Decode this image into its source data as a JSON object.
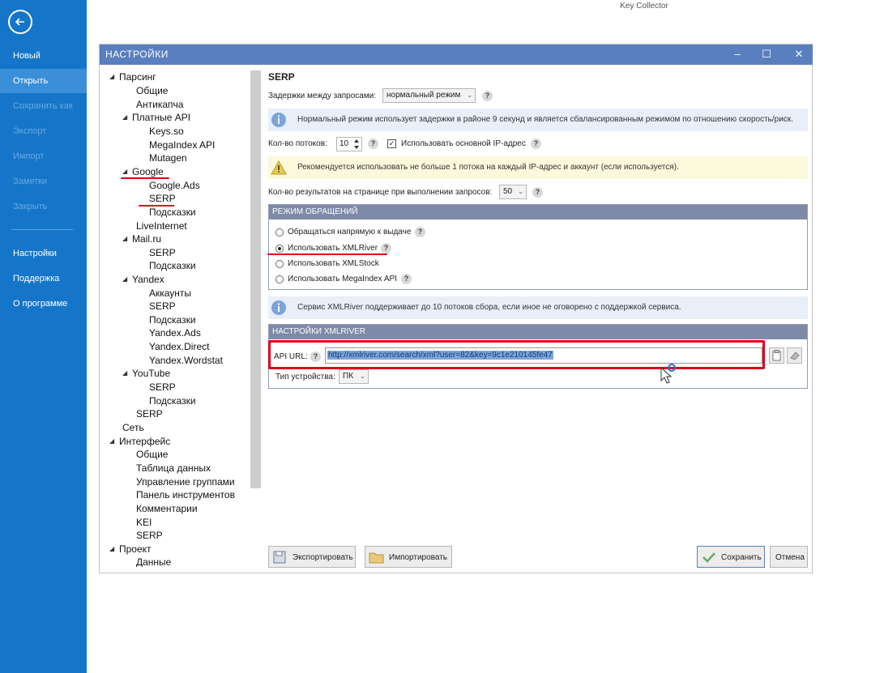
{
  "app": {
    "title": "Key Collector"
  },
  "backstage": {
    "items": [
      {
        "label": "Новый"
      },
      {
        "label": "Открыть"
      },
      {
        "label": "Сохранить как"
      },
      {
        "label": "Экспорт"
      },
      {
        "label": "Импорт"
      },
      {
        "label": "Заметки"
      },
      {
        "label": "Закрыть"
      },
      {
        "label": "Настройки"
      },
      {
        "label": "Поддержка"
      },
      {
        "label": "О программе"
      }
    ]
  },
  "dialog": {
    "title": "НАСТРОЙКИ",
    "controls": {
      "minimize": "–",
      "maximize": "☐",
      "close": "✕"
    }
  },
  "tree": [
    {
      "label": "Парсинг"
    },
    {
      "label": "Общие"
    },
    {
      "label": "Антикапча"
    },
    {
      "label": "Платные API"
    },
    {
      "label": "Keys.so"
    },
    {
      "label": "MegaIndex API"
    },
    {
      "label": "Mutagen"
    },
    {
      "label": "Google"
    },
    {
      "label": "Google.Ads"
    },
    {
      "label": "SERP"
    },
    {
      "label": "Подсказки"
    },
    {
      "label": "LiveInternet"
    },
    {
      "label": "Mail.ru"
    },
    {
      "label": "SERP"
    },
    {
      "label": "Подсказки"
    },
    {
      "label": "Yandex"
    },
    {
      "label": "Аккаунты"
    },
    {
      "label": "SERP"
    },
    {
      "label": "Подсказки"
    },
    {
      "label": "Yandex.Ads"
    },
    {
      "label": "Yandex.Direct"
    },
    {
      "label": "Yandex.Wordstat"
    },
    {
      "label": "YouTube"
    },
    {
      "label": "SERP"
    },
    {
      "label": "Подсказки"
    },
    {
      "label": "SERP"
    },
    {
      "label": "Сеть"
    },
    {
      "label": "Интерфейс"
    },
    {
      "label": "Общие"
    },
    {
      "label": "Таблица данных"
    },
    {
      "label": "Управление группами"
    },
    {
      "label": "Панель инструментов"
    },
    {
      "label": "Комментарии"
    },
    {
      "label": "KEI"
    },
    {
      "label": "SERP"
    },
    {
      "label": "Проект"
    },
    {
      "label": "Данные"
    }
  ],
  "serp": {
    "title": "SERP",
    "delay_label": "Задержки между запросами:",
    "delay_value": "нормальный режим",
    "delay_info": "Нормальный режим использует задержки в районе 9 секунд и является сбалансированным режимом по отношению скорость/риск.",
    "threads_label": "Кол-во потоков:",
    "threads_value": "10",
    "use_main_ip_label": "Использовать основной IP-адрес",
    "use_main_ip_checked": true,
    "warning": "Рекомендуется использовать не больше 1 потока на каждый IP-адрес и аккаунт (если используется).",
    "results_label": "Кол-во результатов на странице при выполнении запросов:",
    "results_value": "50",
    "mode_group": {
      "title": "РЕЖИМ ОБРАЩЕНИЙ",
      "options": [
        {
          "label": "Обращаться напрямую к выдаче",
          "selected": false
        },
        {
          "label": "Использовать XMLRiver",
          "selected": true
        },
        {
          "label": "Использовать XMLStock",
          "selected": false
        },
        {
          "label": "Использовать MegaIndex API",
          "selected": false
        }
      ]
    },
    "xmlriver_info": "Сервис XMLRiver поддерживает до 10 потоков сбора, если иное не оговорено с поддержкой сервиса.",
    "xmlriver_group": {
      "title": "НАСТРОЙКИ XMLRIVER",
      "api_url_label": "API URL:",
      "api_url_value": "http://xmlriver.com/search/xml?user=82&key=9c1e210145fe47",
      "device_label": "Тип устройства:",
      "device_value": "ПК"
    }
  },
  "buttons": {
    "export": "Экспортировать",
    "import": "Импортировать",
    "save": "Сохранить",
    "cancel": "Отмена"
  },
  "help_glyph": "?",
  "colors": {
    "backstage": "#1576c9",
    "titlebar": "#5a7fbf",
    "group_header": "#7e8aa8",
    "annotation_red": "#e0001b"
  }
}
